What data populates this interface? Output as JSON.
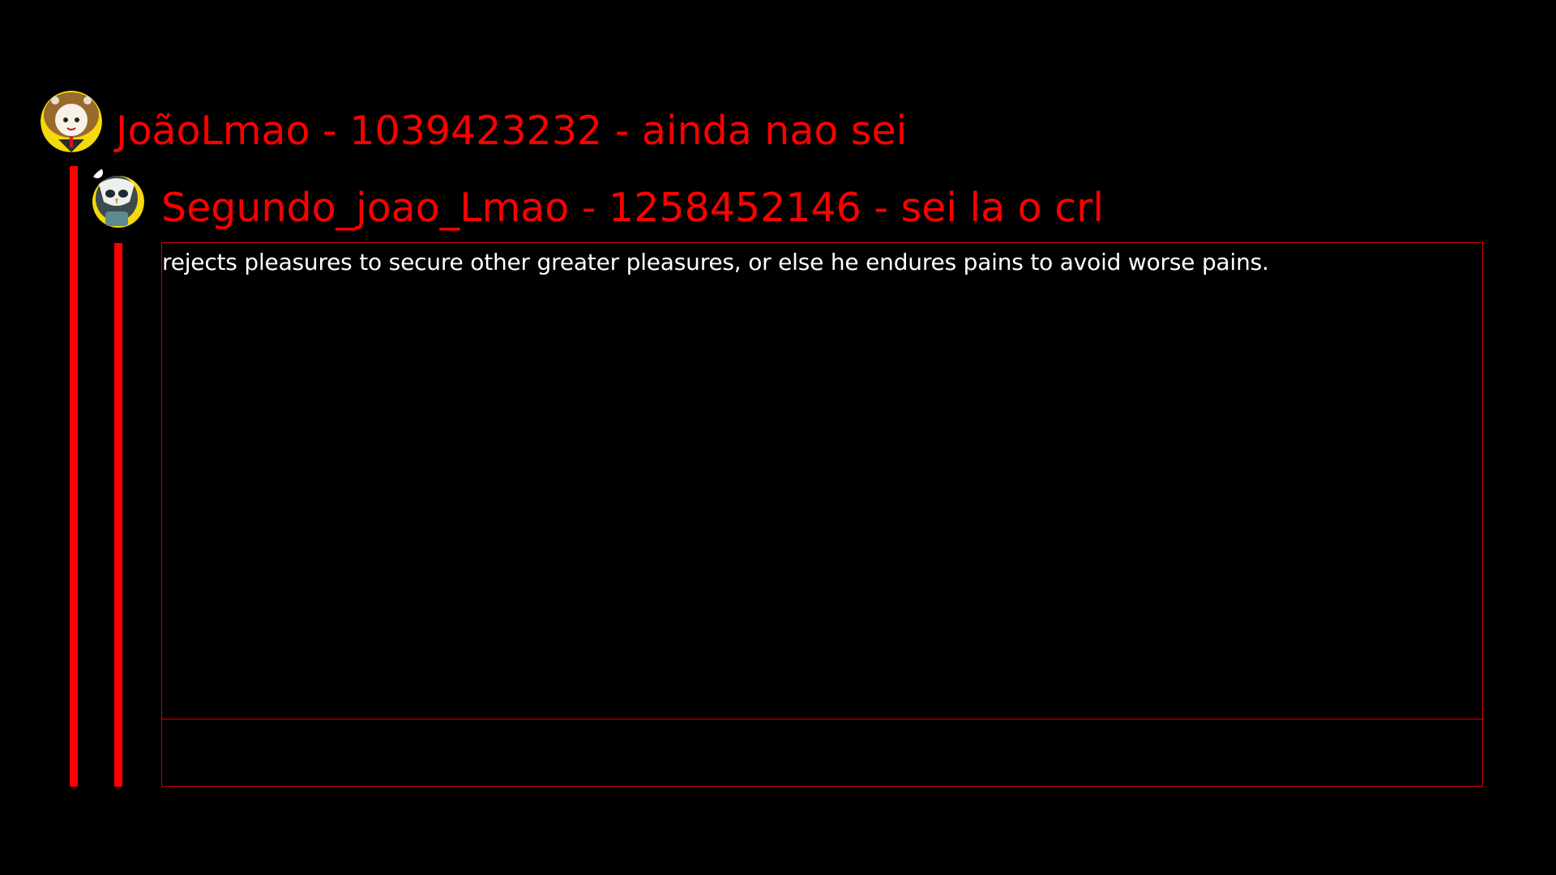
{
  "theme": {
    "background": "#000000",
    "accent": "#ff0000",
    "text": "#ffffff",
    "border": "#d4000a"
  },
  "thread": {
    "parent": {
      "heading": "JoãoLmao - 1039423232 - ainda nao sei",
      "avatar_icon": "lion-hooded-character-avatar-icon"
    },
    "reply": {
      "heading": "Segundo_joao_Lmao - 1258452146 - sei la o crl",
      "avatar_icon": "owl-masked-character-avatar-icon",
      "message": "rejects pleasures to secure other greater pleasures, or else he endures pains to avoid worse pains."
    }
  }
}
